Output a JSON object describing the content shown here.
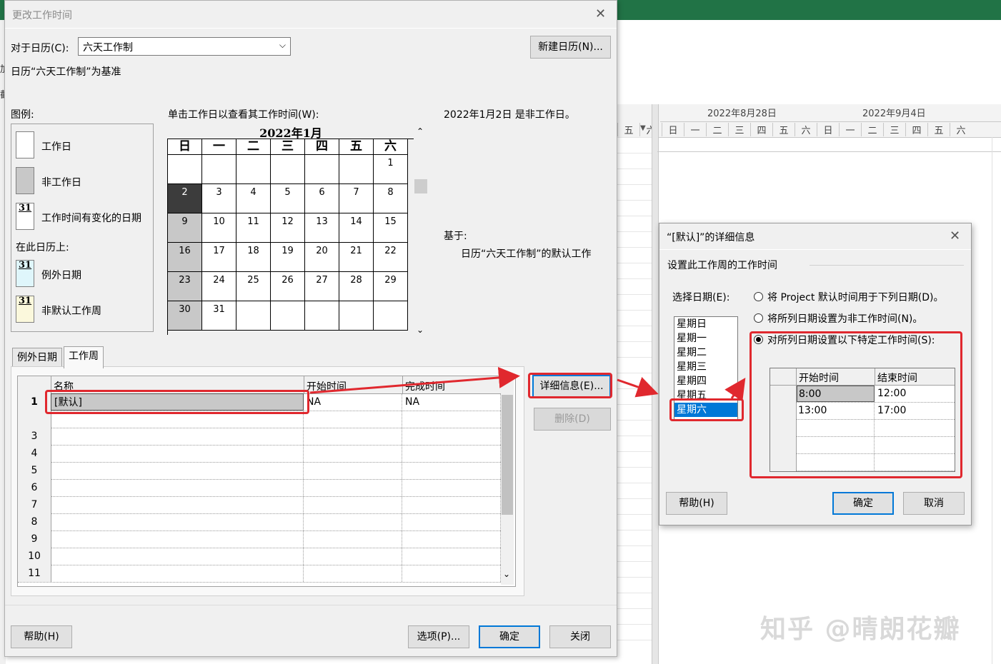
{
  "background_app": {
    "gantt_week1": "2022年8月28日",
    "gantt_week2": "2022年9月4日",
    "gantt_days": [
      "五",
      "六",
      "日",
      "一",
      "二",
      "三",
      "四",
      "五",
      "六",
      "日",
      "一",
      "二",
      "三",
      "四",
      "五",
      "六"
    ],
    "left_fragments": [
      "加",
      "加",
      "截"
    ]
  },
  "main_dialog": {
    "title": "更改工作时间",
    "for_calendar_label": "对于日历(C):",
    "calendar_value": "六天工作制",
    "new_calendar_button": "新建日历(N)...",
    "base_note": "日历“六天工作制”为基准",
    "legend_title": "图例:",
    "legend": {
      "working": "工作日",
      "nonworking": "非工作日",
      "edited": "工作时间有变化的日期",
      "on_this_calendar": "在此日历上:",
      "exception": "例外日期",
      "nondefault_week": "非默认工作周",
      "swatch_num": "31"
    },
    "click_hint": "单击工作日以查看其工作时间(W):",
    "calendar_month": "2022年1月",
    "weekdays": [
      "日",
      "一",
      "二",
      "三",
      "四",
      "五",
      "六"
    ],
    "weeks": [
      [
        "",
        "",
        "",
        "",
        "",
        "",
        "1"
      ],
      [
        "2",
        "3",
        "4",
        "5",
        "6",
        "7",
        "8"
      ],
      [
        "9",
        "10",
        "11",
        "12",
        "13",
        "14",
        "15"
      ],
      [
        "16",
        "17",
        "18",
        "19",
        "20",
        "21",
        "22"
      ],
      [
        "23",
        "24",
        "25",
        "26",
        "27",
        "28",
        "29"
      ],
      [
        "30",
        "31",
        "",
        "",
        "",
        "",
        ""
      ]
    ],
    "day_info": "2022年1月2日 是非工作日。",
    "based_on_label": "基于:",
    "based_on_value": "日历“六天工作制”的默认工作",
    "tabs": [
      "例外日期",
      "工作周"
    ],
    "grid_headers": [
      "名称",
      "开始时间",
      "完成时间"
    ],
    "grid_rows": [
      {
        "num": "1",
        "name": "[默认]",
        "start": "NA",
        "finish": "NA"
      },
      {
        "num": "",
        "name": "",
        "start": "",
        "finish": ""
      },
      {
        "num": "3",
        "name": "",
        "start": "",
        "finish": ""
      },
      {
        "num": "4",
        "name": "",
        "start": "",
        "finish": ""
      },
      {
        "num": "5",
        "name": "",
        "start": "",
        "finish": ""
      },
      {
        "num": "6",
        "name": "",
        "start": "",
        "finish": ""
      },
      {
        "num": "7",
        "name": "",
        "start": "",
        "finish": ""
      },
      {
        "num": "8",
        "name": "",
        "start": "",
        "finish": ""
      },
      {
        "num": "9",
        "name": "",
        "start": "",
        "finish": ""
      },
      {
        "num": "10",
        "name": "",
        "start": "",
        "finish": ""
      },
      {
        "num": "11",
        "name": "",
        "start": "",
        "finish": ""
      }
    ],
    "details_button": "详细信息(E)...",
    "delete_button": "删除(D)",
    "help_button": "帮助(H)",
    "options_button": "选项(P)...",
    "ok_button": "确定",
    "close_button": "关闭"
  },
  "details_dialog": {
    "title": "“[默认]”的详细信息",
    "section": "设置此工作周的工作时间",
    "select_days_label": "选择日期(E):",
    "days": [
      "星期日",
      "星期一",
      "星期二",
      "星期三",
      "星期四",
      "星期五",
      "星期六"
    ],
    "selected_day": "星期六",
    "radio1": "将 Project 默认时间用于下列日期(D)。",
    "radio2": "将所列日期设置为非工作时间(N)。",
    "radio3": "对所列日期设置以下特定工作时间(S):",
    "time_headers": [
      "开始时间",
      "结束时间"
    ],
    "times": [
      {
        "start": "8:00",
        "end": "12:00"
      },
      {
        "start": "13:00",
        "end": "17:00"
      },
      {
        "start": "",
        "end": ""
      },
      {
        "start": "",
        "end": ""
      },
      {
        "start": "",
        "end": ""
      }
    ],
    "help_button": "帮助(H)",
    "ok_button": "确定",
    "cancel_button": "取消"
  },
  "watermark": "知乎 @晴朗花瓣",
  "colors": {
    "annotation_red": "#e0282e",
    "accent": "#0078d7",
    "title_bar_green": "#217346"
  }
}
